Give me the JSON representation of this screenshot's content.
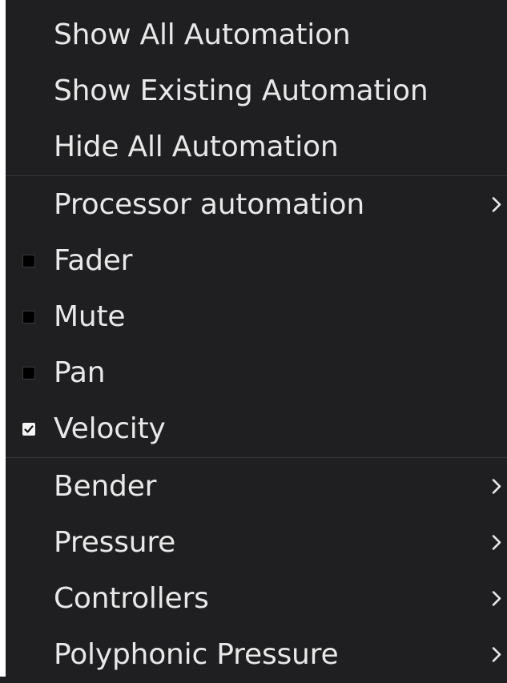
{
  "menu": {
    "items": [
      {
        "label": "Show All Automation"
      },
      {
        "label": "Show Existing Automation"
      },
      {
        "label": "Hide All Automation"
      },
      {
        "label": "Processor automation",
        "submenu": true
      },
      {
        "label": "Fader",
        "checkbox": "unchecked"
      },
      {
        "label": "Mute",
        "checkbox": "unchecked"
      },
      {
        "label": "Pan",
        "checkbox": "unchecked"
      },
      {
        "label": "Velocity",
        "checkbox": "checked"
      },
      {
        "label": "Bender",
        "submenu": true
      },
      {
        "label": "Pressure",
        "submenu": true
      },
      {
        "label": "Controllers",
        "submenu": true
      },
      {
        "label": "Polyphonic Pressure",
        "submenu": true
      }
    ]
  },
  "colors": {
    "background": "#1f1f21",
    "text": "#e8e8e8",
    "separator": "#38383c",
    "left_edge": "#ffffff"
  }
}
